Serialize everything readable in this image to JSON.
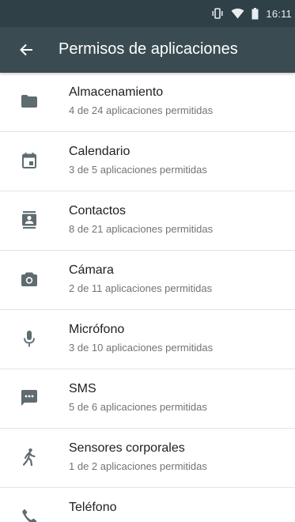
{
  "status_bar": {
    "time": "16:11",
    "icons": [
      "vibrate-icon",
      "wifi-icon",
      "battery-icon"
    ]
  },
  "app_bar": {
    "back_icon": "arrow-back-icon",
    "title": "Permisos de aplicaciones"
  },
  "permissions": [
    {
      "icon": "folder-icon",
      "title": "Almacenamiento",
      "subtitle": "4 de 24 aplicaciones permitidas"
    },
    {
      "icon": "calendar-icon",
      "title": "Calendario",
      "subtitle": "3 de 5 aplicaciones permitidas"
    },
    {
      "icon": "contacts-icon",
      "title": "Contactos",
      "subtitle": "8 de 21 aplicaciones permitidas"
    },
    {
      "icon": "camera-icon",
      "title": "Cámara",
      "subtitle": "2 de 11 aplicaciones permitidas"
    },
    {
      "icon": "microphone-icon",
      "title": "Micrófono",
      "subtitle": "3 de 10 aplicaciones permitidas"
    },
    {
      "icon": "sms-icon",
      "title": "SMS",
      "subtitle": "5 de 6 aplicaciones permitidas"
    },
    {
      "icon": "body-sensor-icon",
      "title": "Sensores corporales",
      "subtitle": "1 de 2 aplicaciones permitidas"
    },
    {
      "icon": "phone-icon",
      "title": "Teléfono",
      "subtitle": ""
    }
  ],
  "colors": {
    "status_bar": "#2f4046",
    "app_bar": "#3a4c52",
    "icon": "#5f6b70",
    "title_text": "#212121",
    "subtitle_text": "#737373"
  }
}
